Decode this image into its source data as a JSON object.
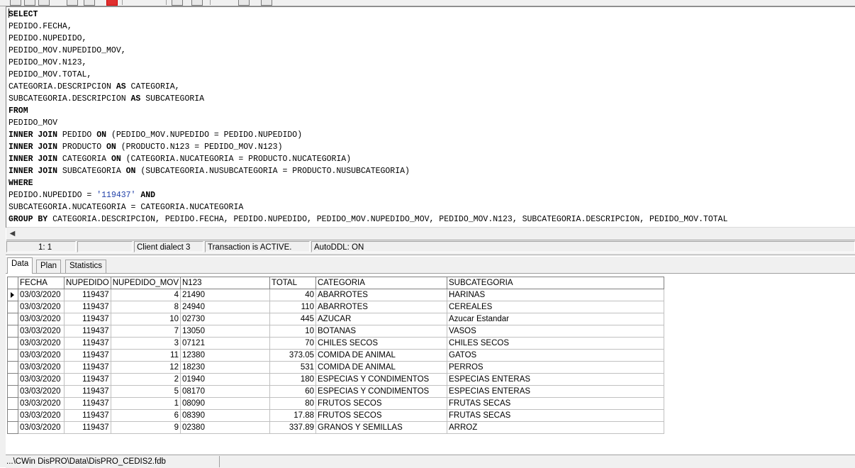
{
  "editor": {
    "lines": [
      [
        {
          "t": "SELECT",
          "k": 1
        }
      ],
      [
        {
          "t": "PEDIDO.FECHA,"
        }
      ],
      [
        {
          "t": "PEDIDO.NUPEDIDO,"
        }
      ],
      [
        {
          "t": "PEDIDO_MOV.NUPEDIDO_MOV,"
        }
      ],
      [
        {
          "t": "PEDIDO_MOV.N123,"
        }
      ],
      [
        {
          "t": "PEDIDO_MOV.TOTAL,"
        }
      ],
      [
        {
          "t": "CATEGORIA.DESCRIPCION "
        },
        {
          "t": "AS",
          "k": 1
        },
        {
          "t": " CATEGORIA,"
        }
      ],
      [
        {
          "t": "SUBCATEGORIA.DESCRIPCION "
        },
        {
          "t": "AS",
          "k": 1
        },
        {
          "t": " SUBCATEGORIA"
        }
      ],
      [
        {
          "t": "FROM",
          "k": 1
        }
      ],
      [
        {
          "t": "PEDIDO_MOV"
        }
      ],
      [
        {
          "t": "INNER JOIN",
          "k": 1
        },
        {
          "t": " PEDIDO "
        },
        {
          "t": "ON",
          "k": 1
        },
        {
          "t": " (PEDIDO_MOV.NUPEDIDO = PEDIDO.NUPEDIDO)"
        }
      ],
      [
        {
          "t": "INNER JOIN",
          "k": 1
        },
        {
          "t": " PRODUCTO "
        },
        {
          "t": "ON",
          "k": 1
        },
        {
          "t": " (PRODUCTO.N123 = PEDIDO_MOV.N123)"
        }
      ],
      [
        {
          "t": "INNER JOIN",
          "k": 1
        },
        {
          "t": " CATEGORIA "
        },
        {
          "t": "ON",
          "k": 1
        },
        {
          "t": " (CATEGORIA.NUCATEGORIA = PRODUCTO.NUCATEGORIA)"
        }
      ],
      [
        {
          "t": "INNER JOIN",
          "k": 1
        },
        {
          "t": " SUBCATEGORIA "
        },
        {
          "t": "ON",
          "k": 1
        },
        {
          "t": " (SUBCATEGORIA.NUSUBCATEGORIA = PRODUCTO.NUSUBCATEGORIA)"
        }
      ],
      [
        {
          "t": "WHERE",
          "k": 1
        }
      ],
      [
        {
          "t": "PEDIDO.NUPEDIDO = "
        },
        {
          "t": "'119437'",
          "s": 1
        },
        {
          "t": " "
        },
        {
          "t": "AND",
          "k": 1
        }
      ],
      [
        {
          "t": "SUBCATEGORIA.NUCATEGORIA = CATEGORIA.NUCATEGORIA"
        }
      ],
      [
        {
          "t": "GROUP BY",
          "k": 1
        },
        {
          "t": " CATEGORIA.DESCRIPCION, PEDIDO.FECHA, PEDIDO.NUPEDIDO, PEDIDO_MOV.NUPEDIDO_MOV, PEDIDO_MOV.N123, SUBCATEGORIA.DESCRIPCION, PEDIDO_MOV.TOTAL"
        }
      ]
    ]
  },
  "status": {
    "position": "1:  1",
    "dialect": "Client dialect 3",
    "transaction": "Transaction is ACTIVE.",
    "autoddl": "AutoDDL: ON"
  },
  "tabs": [
    "Data",
    "Plan",
    "Statistics"
  ],
  "grid": {
    "columns": [
      "FECHA",
      "NUPEDIDO",
      "NUPEDIDO_MOV",
      "N123",
      "TOTAL",
      "CATEGORIA",
      "SUBCATEGORIA"
    ],
    "rows": [
      [
        "03/03/2020",
        "119437",
        "4",
        "21490",
        "40",
        "ABARROTES",
        "HARINAS"
      ],
      [
        "03/03/2020",
        "119437",
        "8",
        "24940",
        "110",
        "ABARROTES",
        "CEREALES"
      ],
      [
        "03/03/2020",
        "119437",
        "10",
        "02730",
        "445",
        "AZUCAR",
        "Azucar Estandar"
      ],
      [
        "03/03/2020",
        "119437",
        "7",
        "13050",
        "10",
        "BOTANAS",
        "VASOS"
      ],
      [
        "03/03/2020",
        "119437",
        "3",
        "07121",
        "70",
        "CHILES SECOS",
        "CHILES SECOS"
      ],
      [
        "03/03/2020",
        "119437",
        "11",
        "12380",
        "373.05",
        "COMIDA DE ANIMAL",
        "GATOS"
      ],
      [
        "03/03/2020",
        "119437",
        "12",
        "18230",
        "531",
        "COMIDA DE ANIMAL",
        "PERROS"
      ],
      [
        "03/03/2020",
        "119437",
        "2",
        "01940",
        "180",
        "ESPECIAS Y CONDIMENTOS",
        "ESPECIAS ENTERAS"
      ],
      [
        "03/03/2020",
        "119437",
        "5",
        "08170",
        "60",
        "ESPECIAS Y CONDIMENTOS",
        "ESPECIAS ENTERAS"
      ],
      [
        "03/03/2020",
        "119437",
        "1",
        "08090",
        "80",
        "FRUTOS SECOS",
        "FRUTAS SECAS"
      ],
      [
        "03/03/2020",
        "119437",
        "6",
        "08390",
        "17.88",
        "FRUTOS SECOS",
        "FRUTAS SECAS"
      ],
      [
        "03/03/2020",
        "119437",
        "9",
        "02380",
        "337.89",
        "GRANOS Y SEMILLAS",
        "ARROZ"
      ]
    ]
  },
  "footer": {
    "db_path": "...\\CWin DisPRO\\Data\\DisPRO_CEDIS2.fdb"
  }
}
